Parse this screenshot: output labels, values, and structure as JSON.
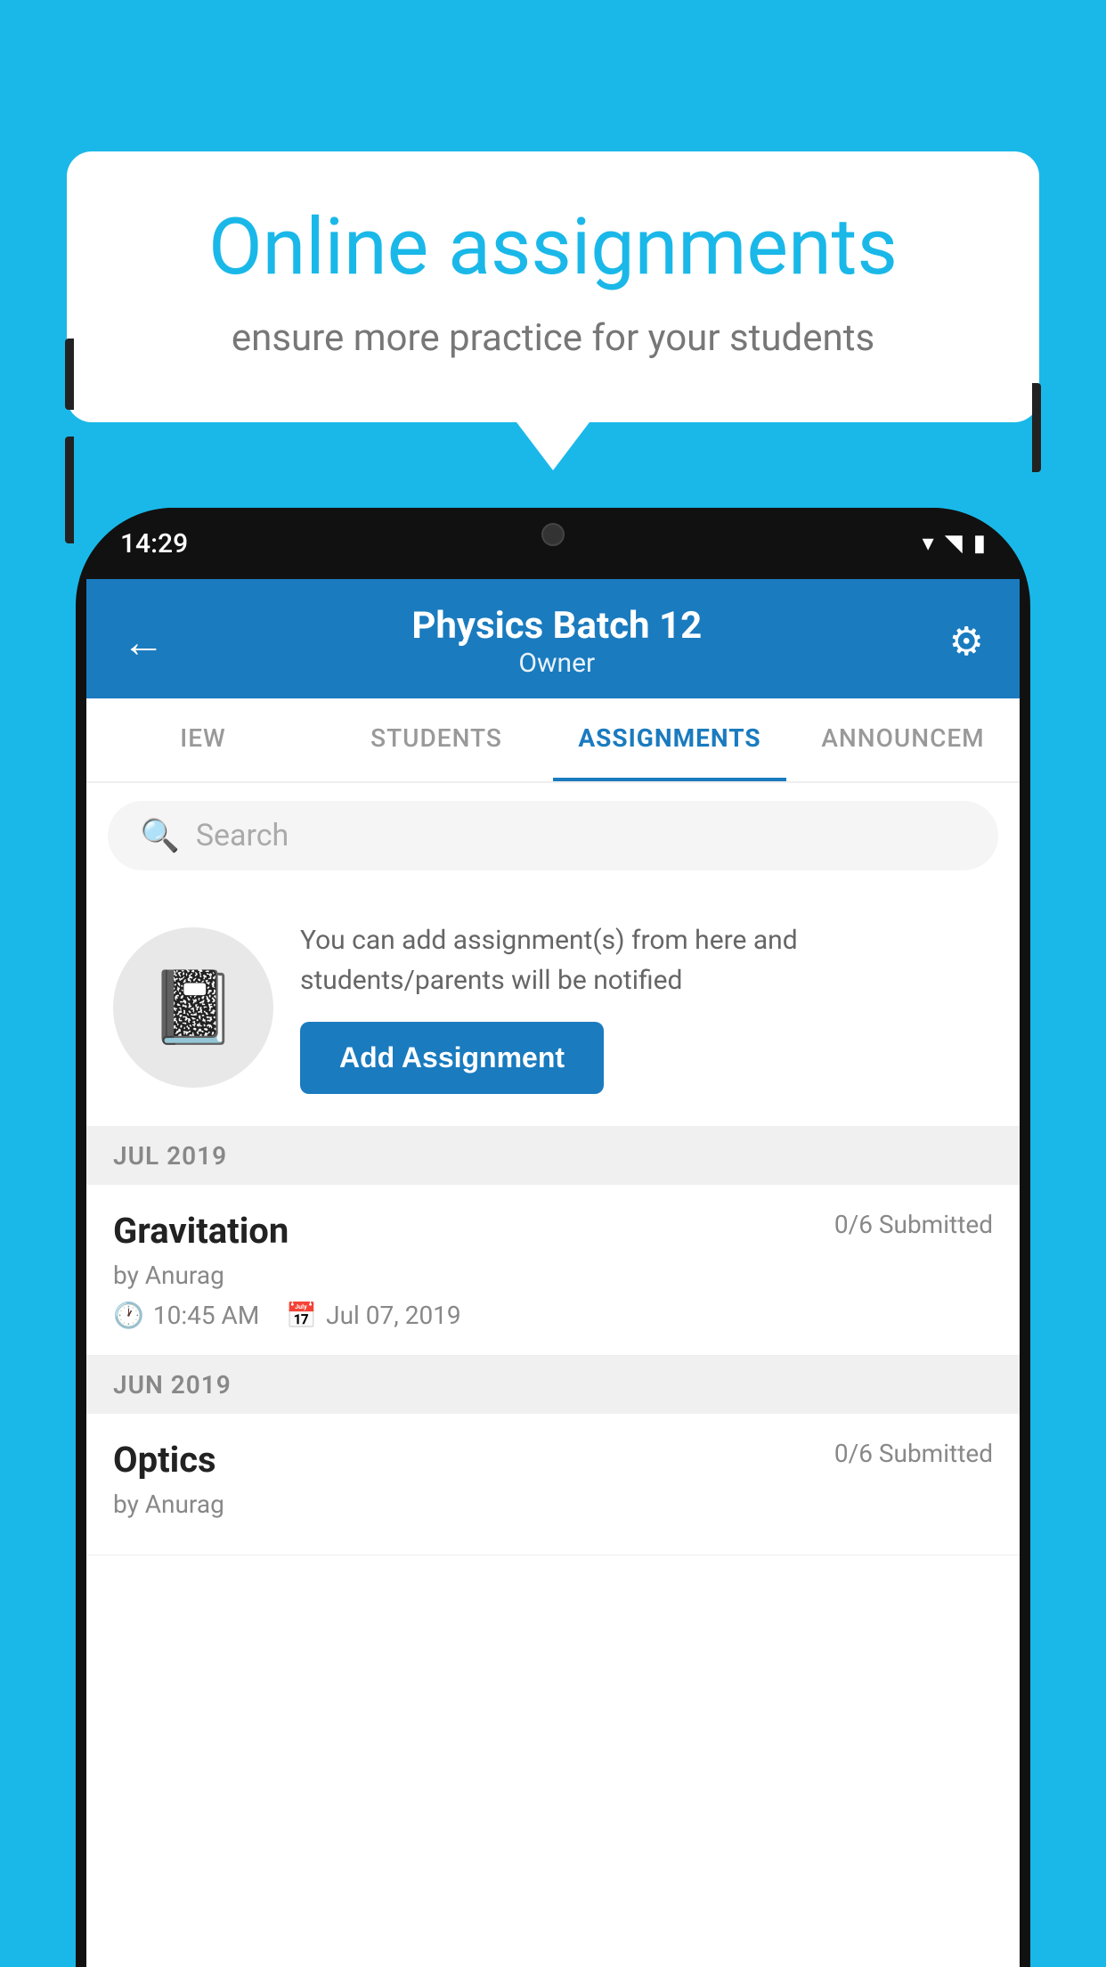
{
  "background_color": "#1ab8e8",
  "speech_bubble": {
    "title": "Online assignments",
    "subtitle": "ensure more practice for your students"
  },
  "phone": {
    "status_time": "14:29",
    "header": {
      "title": "Physics Batch 12",
      "subtitle": "Owner",
      "back_label": "←",
      "gear_label": "⚙"
    },
    "tabs": [
      {
        "label": "IEW",
        "active": false
      },
      {
        "label": "STUDENTS",
        "active": false
      },
      {
        "label": "ASSIGNMENTS",
        "active": true
      },
      {
        "label": "ANNOUNCEM",
        "active": false
      }
    ],
    "search": {
      "placeholder": "Search"
    },
    "promo": {
      "text": "You can add assignment(s) from here and students/parents will be notified",
      "button_label": "Add Assignment"
    },
    "assignments": [
      {
        "month_label": "JUL 2019",
        "items": [
          {
            "name": "Gravitation",
            "submitted": "0/6 Submitted",
            "by": "by Anurag",
            "time": "10:45 AM",
            "date": "Jul 07, 2019"
          }
        ]
      },
      {
        "month_label": "JUN 2019",
        "items": [
          {
            "name": "Optics",
            "submitted": "0/6 Submitted",
            "by": "by Anurag",
            "time": "",
            "date": ""
          }
        ]
      }
    ]
  }
}
